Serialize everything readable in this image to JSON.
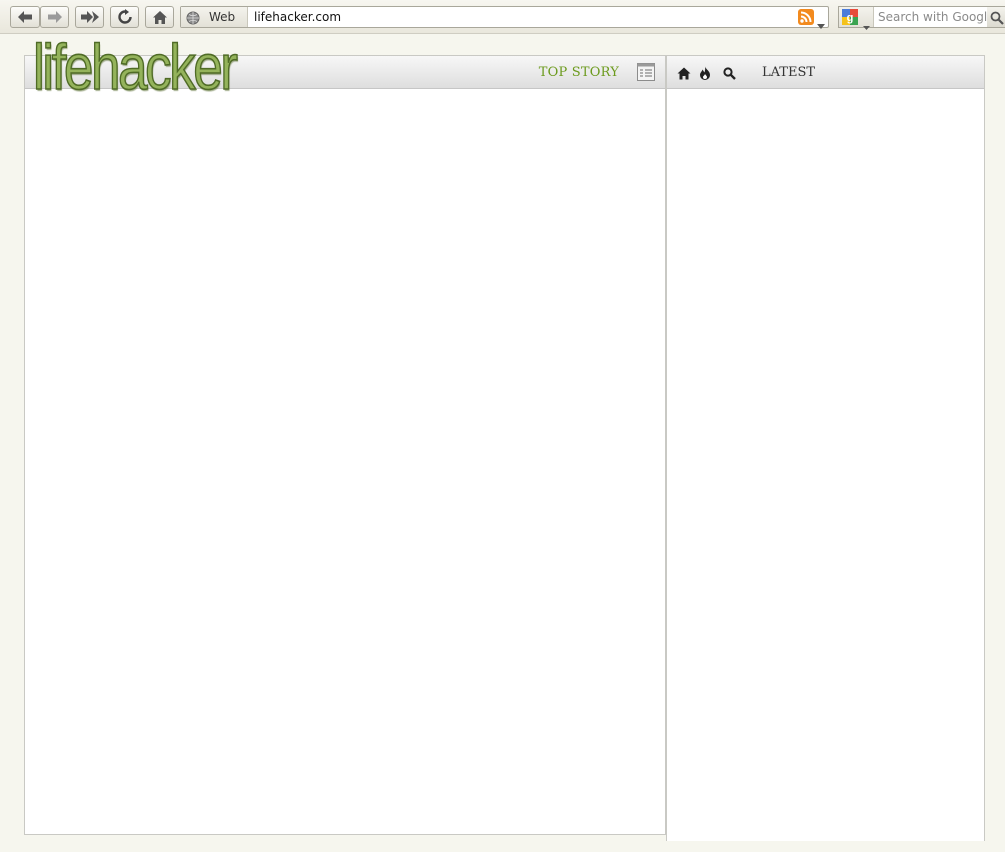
{
  "browser": {
    "url_label": "Web",
    "url": "lifehacker.com",
    "search_placeholder": "Search with Google"
  },
  "site": {
    "logo_text": "lifehacker",
    "top_story_label": "TOP STORY",
    "latest_label": "LATEST"
  },
  "colors": {
    "accent_green": "#6b9a1c",
    "logo_green": "#94b35b"
  },
  "icons": {
    "back": "back-arrow-icon",
    "forward": "forward-arrow-icon",
    "fast_forward": "fast-forward-icon",
    "reload": "reload-icon",
    "home": "home-icon",
    "globe": "globe-icon",
    "rss": "rss-icon",
    "list": "list-view-icon",
    "fire": "fire-icon",
    "search": "search-icon"
  }
}
